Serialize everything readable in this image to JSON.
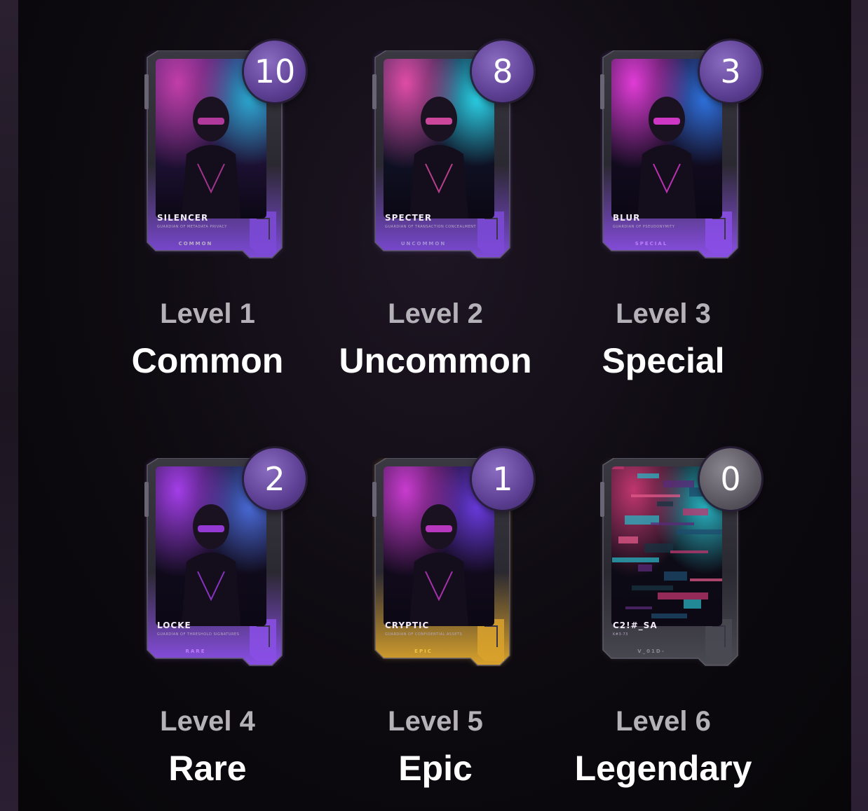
{
  "cards": [
    {
      "name": "SILENCER",
      "subtitle": "GUARDIAN OF METADATA PRIVACY",
      "rarity": "COMMON",
      "count": "10",
      "level": "Level 1",
      "tier": "Common",
      "accent": "#7d4ad8",
      "rarity_color": "#b9b0c4",
      "glow": "#8a5be0",
      "art_colors": [
        "#3c1f6b",
        "#c23ea8",
        "#2ba9d1"
      ]
    },
    {
      "name": "SPECTER",
      "subtitle": "GUARDIAN OF TRANSACTION CONCEALMENT",
      "rarity": "UNCOMMON",
      "count": "8",
      "level": "Level 2",
      "tier": "Uncommon",
      "accent": "#7d4ad8",
      "rarity_color": "#a48fd6",
      "glow": "#8a5be0",
      "art_colors": [
        "#13203d",
        "#e04ca8",
        "#2bd1e6"
      ]
    },
    {
      "name": "BLUR",
      "subtitle": "GUARDIAN OF PSEUDONYMITY",
      "rarity": "SPECIAL",
      "count": "3",
      "level": "Level 3",
      "tier": "Special",
      "accent": "#8a4fe6",
      "rarity_color": "#c07cff",
      "glow": "#9b60f0",
      "art_colors": [
        "#1a1030",
        "#e13cd6",
        "#2f73e0"
      ]
    },
    {
      "name": "LOCKE",
      "subtitle": "GUARDIAN OF THRESHOLD SIGNATURES",
      "rarity": "RARE",
      "count": "2",
      "level": "Level 4",
      "tier": "Rare",
      "accent": "#8a4fe6",
      "rarity_color": "#c07cff",
      "glow": "#9b60f0",
      "art_colors": [
        "#160f28",
        "#a33ee8",
        "#4a6bd8"
      ]
    },
    {
      "name": "CRYPTIC",
      "subtitle": "GUARDIAN OF CONFIDENTIAL ASSETS",
      "rarity": "EPIC",
      "count": "1",
      "level": "Level 5",
      "tier": "Epic",
      "accent": "#d9a22c",
      "rarity_color": "#f3c43f",
      "glow": "#e0a22e",
      "art_colors": [
        "#1b0e2a",
        "#c93ccf",
        "#6a3be0"
      ]
    },
    {
      "name": "C2!#_SA",
      "subtitle": "K#3-73",
      "rarity": "V_01D-",
      "count": "0",
      "level": "Level 6",
      "tier": "Legendary",
      "accent": "#4a4a52",
      "rarity_color": "#8e8b92",
      "glow": "#55535a",
      "art_colors": [
        "#0e1018",
        "#c0366f",
        "#2ab3c2"
      ]
    }
  ]
}
